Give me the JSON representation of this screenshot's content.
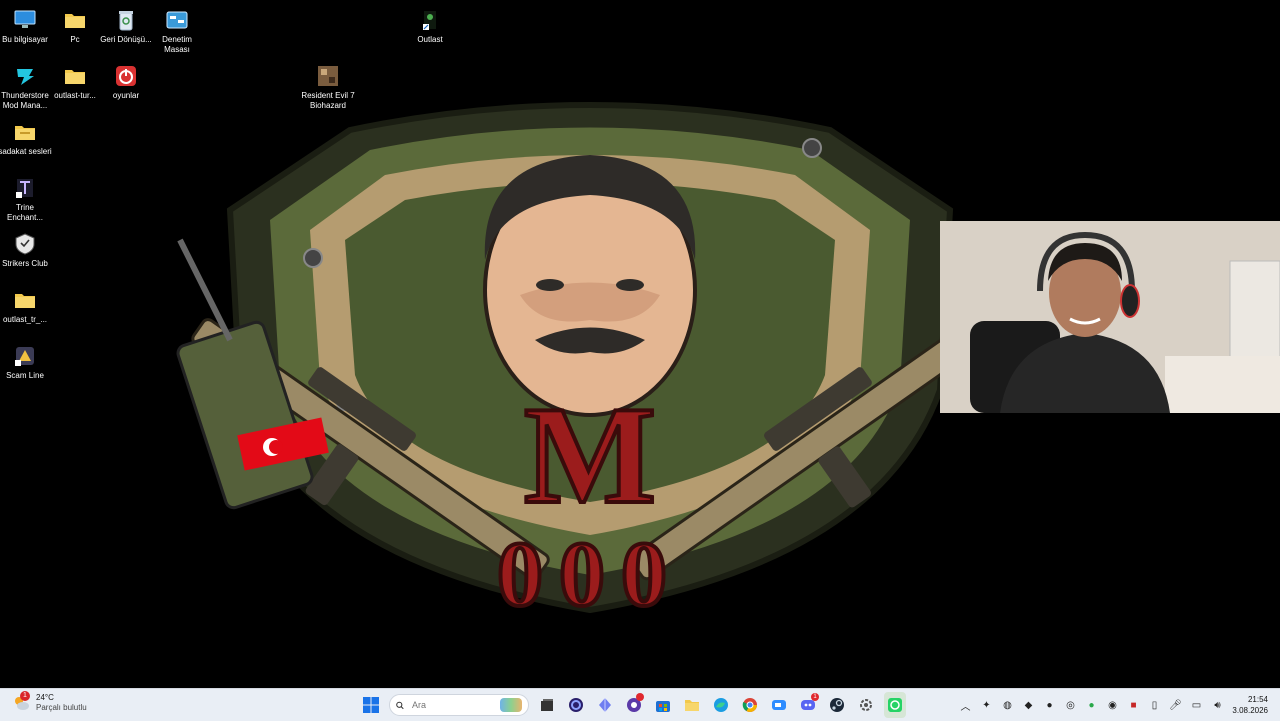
{
  "desktop": {
    "icons": [
      {
        "label": "Bu bilgisayar"
      },
      {
        "label": "Pc"
      },
      {
        "label": "Geri Dönüşü..."
      },
      {
        "label": "Denetim Masası"
      },
      {
        "label": "Outlast"
      },
      {
        "label": "Thunderstore Mod Mana..."
      },
      {
        "label": "outlast-tur..."
      },
      {
        "label": "oyunlar"
      },
      {
        "label": "Resident Evil 7 Biohazard"
      },
      {
        "label": "sadakat sesleri"
      },
      {
        "label": "Trine Enchant..."
      },
      {
        "label": "Strikers Club"
      },
      {
        "label": "outlast_tr_..."
      },
      {
        "label": "Scam Line"
      }
    ]
  },
  "wallpaper": {
    "emblem_letter": "M",
    "emblem_digits": "000"
  },
  "taskbar": {
    "weather": {
      "temp": "24°C",
      "condition": "Parçalı bulutlu",
      "badge": "1"
    },
    "search": {
      "placeholder": "Ara"
    },
    "pinned": [
      {
        "icon": "windows-start-icon"
      },
      {
        "icon": "task-view-icon"
      },
      {
        "icon": "cortana-circle-icon"
      },
      {
        "icon": "kite-icon"
      },
      {
        "icon": "github-desktop-icon"
      },
      {
        "icon": "store-icon"
      },
      {
        "icon": "file-explorer-icon"
      },
      {
        "icon": "edge-icon"
      },
      {
        "icon": "chrome-icon"
      },
      {
        "icon": "zoom-icon"
      },
      {
        "icon": "discord-icon",
        "badge": "1"
      },
      {
        "icon": "steam-icon"
      },
      {
        "icon": "settings-icon"
      },
      {
        "icon": "whatsapp-icon"
      }
    ],
    "clock": {
      "time": "21:54",
      "date": "3.08.2026"
    }
  },
  "colors": {
    "taskbar_bg": "#e9eef5",
    "desktop_bg": "#000000",
    "emblem_red": "#9b1c1c",
    "emblem_green": "#3f4a2a"
  }
}
